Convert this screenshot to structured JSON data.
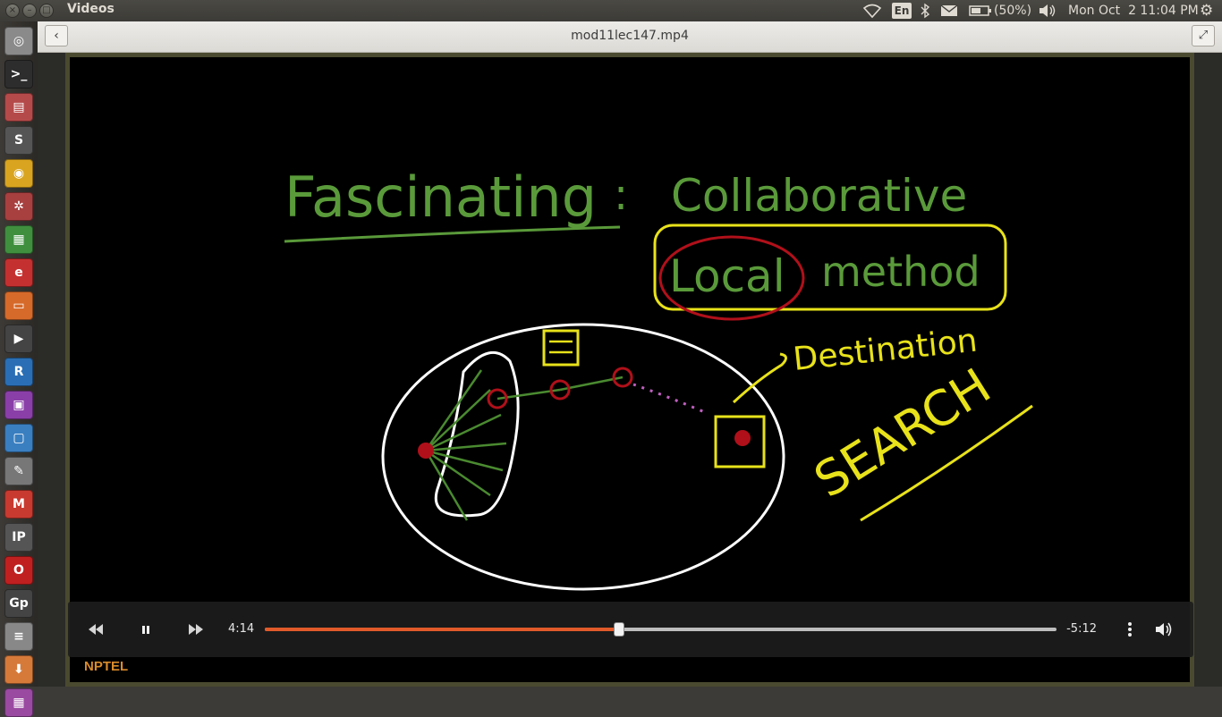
{
  "window": {
    "app_title": "Videos",
    "file_title": "mod11lec147.mp4"
  },
  "panel": {
    "keyboard_layout": "En",
    "battery": "(50%)",
    "datetime": "Mon Oct  2 11:04 PM",
    "icons": [
      "wifi-icon",
      "keyboard-icon",
      "bluetooth-icon",
      "mail-icon",
      "battery-icon",
      "volume-icon",
      "settings-gear-icon"
    ]
  },
  "launcher": {
    "items": [
      {
        "name": "dash-home",
        "glyph": "◎",
        "color": "#8a8a8a"
      },
      {
        "name": "terminal",
        "glyph": ">_",
        "color": "#2d2d2d"
      },
      {
        "name": "file-cabinet",
        "glyph": "▤",
        "color": "#b54a4a"
      },
      {
        "name": "sublime-text",
        "glyph": "S",
        "color": "#555555"
      },
      {
        "name": "chrome",
        "glyph": "◉",
        "color": "#d9a520"
      },
      {
        "name": "spider-app",
        "glyph": "✲",
        "color": "#a84040"
      },
      {
        "name": "spreadsheet",
        "glyph": "▦",
        "color": "#3f8f3f"
      },
      {
        "name": "pdf-viewer",
        "glyph": "e",
        "color": "#c43030"
      },
      {
        "name": "presentation",
        "glyph": "▭",
        "color": "#d66a2a"
      },
      {
        "name": "video-editor",
        "glyph": "▶",
        "color": "#444444"
      },
      {
        "name": "r-language",
        "glyph": "R",
        "color": "#2a6fb5"
      },
      {
        "name": "media-tool",
        "glyph": "▣",
        "color": "#8a3fa8"
      },
      {
        "name": "document-viewer",
        "glyph": "▢",
        "color": "#3a7fc0"
      },
      {
        "name": "text-editor",
        "glyph": "✎",
        "color": "#777777"
      },
      {
        "name": "gmail",
        "glyph": "M",
        "color": "#c83a30"
      },
      {
        "name": "ipython",
        "glyph": "IP",
        "color": "#555555"
      },
      {
        "name": "opera",
        "glyph": "O",
        "color": "#c02020"
      },
      {
        "name": "gp-app",
        "glyph": "Gp",
        "color": "#444444"
      },
      {
        "name": "drive-stack",
        "glyph": "≡",
        "color": "#888888"
      },
      {
        "name": "install-tool",
        "glyph": "⬇",
        "color": "#d67a3a"
      },
      {
        "name": "extra-app",
        "glyph": "▦",
        "color": "#9a4aa0"
      }
    ]
  },
  "video": {
    "slide_title": "Fascinating",
    "slide_colon": ":",
    "slide_collaborative": "Collaborative",
    "slide_local": "Local",
    "slide_method": "method",
    "slide_destination": "Destination",
    "slide_search": "SEARCH",
    "logo_text": "NPTEL"
  },
  "player": {
    "elapsed": "4:14",
    "remaining": "-5:12",
    "progress_fraction": 0.4475,
    "accent_color": "#e05a2a"
  }
}
